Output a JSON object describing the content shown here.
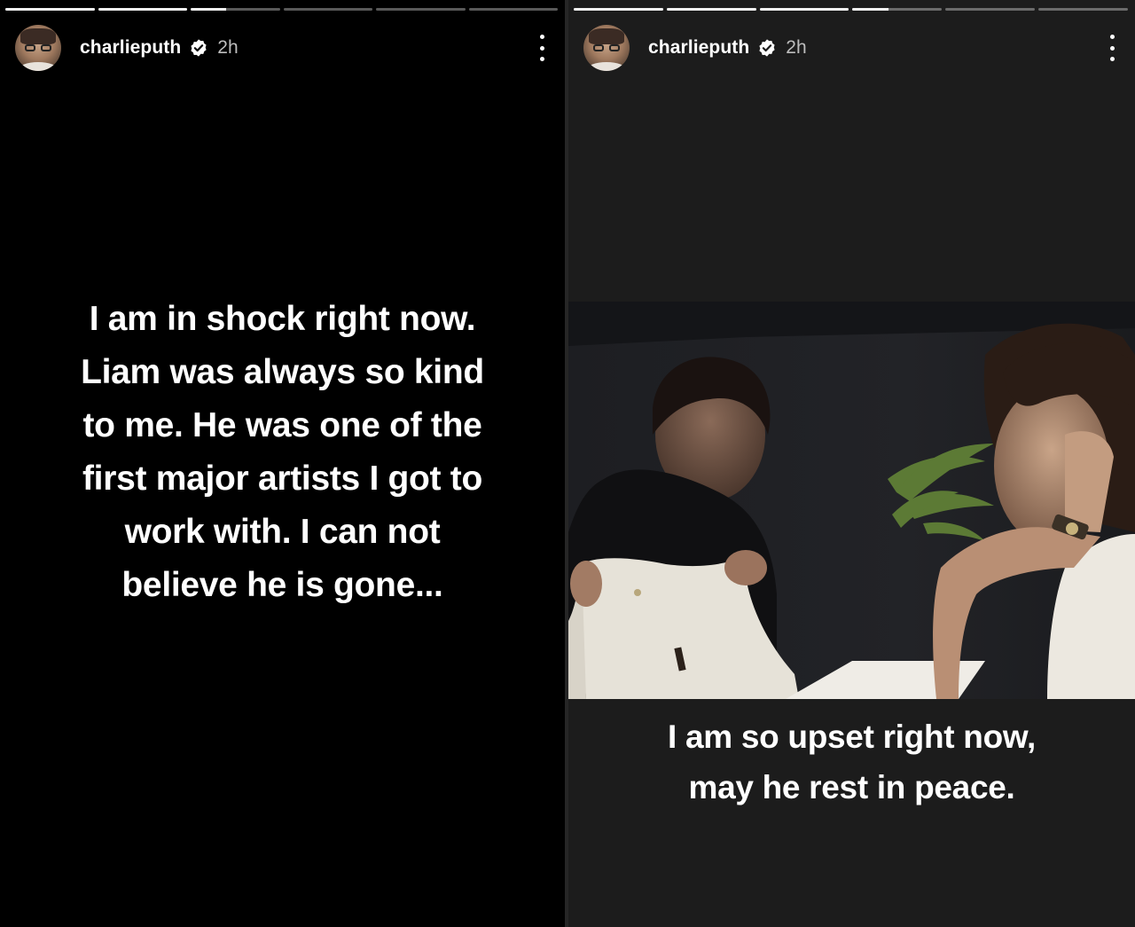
{
  "stories": [
    {
      "username": "charlieputh",
      "time": "2h",
      "progress": [
        1,
        1,
        0.4,
        0,
        0,
        0
      ],
      "caption_lines": [
        "I am in shock right now.",
        "Liam was always so kind",
        "to me. He was one of the",
        "first major artists I got to",
        "work with. I can not",
        "believe he is gone..."
      ]
    },
    {
      "username": "charlieputh",
      "time": "2h",
      "progress": [
        1,
        1,
        1,
        0.4,
        0,
        0
      ],
      "caption_lines": [
        "I am so upset right now,",
        "may he rest in peace."
      ]
    }
  ],
  "colors": {
    "left_background": "#000000",
    "right_background": "#1c1c1c",
    "text": "#ffffff",
    "timestamp": "#bdbdbd",
    "verified_badge": "#ffffff"
  },
  "icons": {
    "verified": "verified-badge-icon",
    "more": "more-options-icon"
  }
}
